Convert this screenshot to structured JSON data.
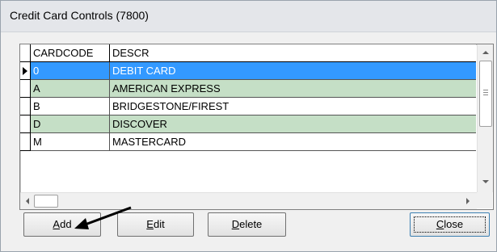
{
  "window": {
    "title": "Credit Card Controls (7800)"
  },
  "grid": {
    "columns": [
      "CARDCODE",
      "DESCR"
    ],
    "rows": [
      {
        "code": "0",
        "descr": "DEBIT CARD",
        "state": "selected"
      },
      {
        "code": "A",
        "descr": "AMERICAN EXPRESS",
        "state": "green"
      },
      {
        "code": "B",
        "descr": "BRIDGESTONE/FIREST",
        "state": "white"
      },
      {
        "code": "D",
        "descr": "DISCOVER",
        "state": "green"
      },
      {
        "code": "M",
        "descr": "MASTERCARD",
        "state": "white"
      }
    ]
  },
  "buttons": {
    "add": {
      "mnemonic": "A",
      "rest": "dd"
    },
    "edit": {
      "mnemonic": "E",
      "rest": "dit"
    },
    "delete": {
      "mnemonic": "D",
      "rest": "elete"
    },
    "close": {
      "mnemonic": "C",
      "rest": "lose"
    }
  },
  "colors": {
    "selected_row": "#3399ff",
    "alt_row": "#c5dfc6",
    "annotation_arrow": "#000000"
  }
}
